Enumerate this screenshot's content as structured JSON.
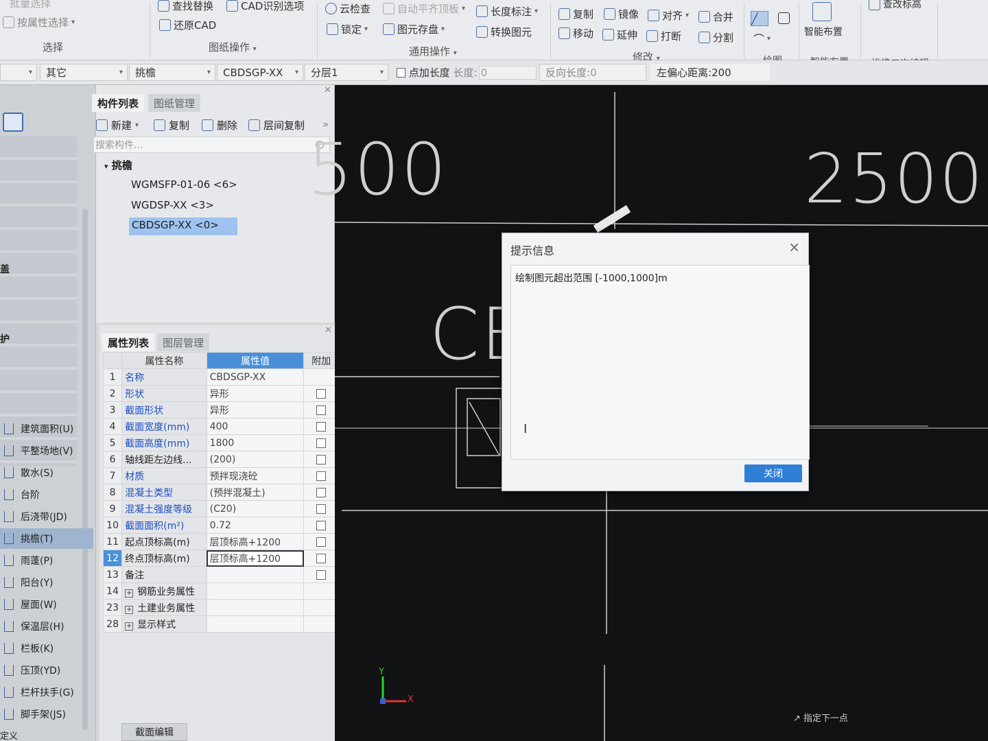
{
  "ribbon": {
    "select_group": {
      "top_label": "批量选择",
      "attr_select": "按属性选择",
      "group_label": "选择"
    },
    "drawing_ops": {
      "find_replace": "查找替换",
      "cad_options": "CAD识别选项",
      "restore_cad": "还原CAD",
      "group_label": "图纸操作"
    },
    "general_ops": {
      "cloud_check": "云检查",
      "auto_flush": "自动平齐顶板",
      "length_mark": "长度标注",
      "lock": "锁定",
      "save_elements": "图元存盘",
      "convert": "转换图元",
      "group_label": "通用操作"
    },
    "modify": {
      "copy": "复制",
      "mirror": "镜像",
      "align": "对齐",
      "merge": "合并",
      "move": "移动",
      "extend": "延伸",
      "break": "打断",
      "split": "分割",
      "group_label": "修改"
    },
    "draw": {
      "group_label": "绘图"
    },
    "smart": {
      "button": "智能布置",
      "group_label": "智能布置"
    },
    "edit2": {
      "view_elev": "查改标高",
      "group_label": "挑檐二次编辑"
    }
  },
  "propbar": {
    "dd1": "",
    "dd2": "其它",
    "dd3": "挑檐",
    "dd4": "CBDSGP-XX",
    "dd5": "分层1",
    "add_length": "点加长度",
    "length_label": "长度:",
    "length_value": "0",
    "reverse_label": "反向长度:",
    "reverse_value": "0",
    "offset_label": "左偏心距离:",
    "offset_value": "200"
  },
  "leftnav": {
    "items": [
      {
        "label": "建筑面积(U)",
        "icon": "building-area-icon"
      },
      {
        "label": "平整场地(V)",
        "icon": "site-leveling-icon"
      },
      {
        "label": "散水(S)",
        "icon": "apron-icon"
      },
      {
        "label": "台阶",
        "icon": "steps-icon"
      },
      {
        "label": "后浇带(JD)",
        "icon": "post-cast-strip-icon"
      },
      {
        "label": "挑檐(T)",
        "icon": "eave-icon",
        "active": true
      },
      {
        "label": "雨蓬(P)",
        "icon": "canopy-icon"
      },
      {
        "label": "阳台(Y)",
        "icon": "balcony-icon"
      },
      {
        "label": "屋面(W)",
        "icon": "roof-icon"
      },
      {
        "label": "保温层(H)",
        "icon": "insulation-icon"
      },
      {
        "label": "栏板(K)",
        "icon": "parapet-icon"
      },
      {
        "label": "压顶(YD)",
        "icon": "coping-icon"
      },
      {
        "label": "栏杆扶手(G)",
        "icon": "railing-icon"
      },
      {
        "label": "脚手架(JS)",
        "icon": "scaffold-icon"
      }
    ],
    "side_labels": [
      "盖",
      "护"
    ],
    "footer": "定义"
  },
  "component_panel": {
    "tabs": [
      "构件列表",
      "图纸管理"
    ],
    "toolbar": {
      "new": "新建",
      "copy": "复制",
      "delete": "删除",
      "floor_copy": "层间复制"
    },
    "search_placeholder": "搜索构件...",
    "tree_root": "挑檐",
    "tree_items": [
      "WGMSFP-01-06 <6>",
      "WGDSP-XX <3>",
      "CBDSGP-XX <0>"
    ]
  },
  "property_panel": {
    "tabs": [
      "属性列表",
      "图层管理"
    ],
    "headers": [
      "属性名称",
      "属性值",
      "附加"
    ],
    "rows": [
      {
        "no": "1",
        "name": "名称",
        "value": "CBDSGP-XX",
        "check": false
      },
      {
        "no": "2",
        "name": "形状",
        "value": "异形",
        "check": true
      },
      {
        "no": "3",
        "name": "截面形状",
        "value": "异形",
        "check": true
      },
      {
        "no": "4",
        "name": "截面宽度(mm)",
        "value": "400",
        "check": true
      },
      {
        "no": "5",
        "name": "截面高度(mm)",
        "value": "1800",
        "check": true
      },
      {
        "no": "6",
        "name": "轴线距左边线...",
        "value": "(200)",
        "check": true,
        "black": true
      },
      {
        "no": "7",
        "name": "材质",
        "value": "预拌现浇砼",
        "check": true
      },
      {
        "no": "8",
        "name": "混凝土类型",
        "value": "(预拌混凝土)",
        "check": true
      },
      {
        "no": "9",
        "name": "混凝土强度等级",
        "value": "(C20)",
        "check": true
      },
      {
        "no": "10",
        "name": "截面面积(m²)",
        "value": "0.72",
        "check": true
      },
      {
        "no": "11",
        "name": "起点顶标高(m)",
        "value": "层顶标高+1200",
        "check": true,
        "black": true
      },
      {
        "no": "12",
        "name": "终点顶标高(m)",
        "value": "层顶标高+1200",
        "check": true,
        "black": true,
        "selected": true
      },
      {
        "no": "13",
        "name": "备注",
        "value": "",
        "check": true,
        "black": true
      },
      {
        "no": "14",
        "name": "钢筋业务属性",
        "value": "",
        "check": false,
        "black": true,
        "group": true
      },
      {
        "no": "23",
        "name": "土建业务属性",
        "value": "",
        "check": false,
        "black": true,
        "group": true
      },
      {
        "no": "28",
        "name": "显示样式",
        "value": "",
        "check": false,
        "black": true,
        "group": true
      }
    ],
    "bottom_button": "截面编辑"
  },
  "canvas": {
    "dim_left": "500",
    "dim_right": "2500",
    "label_cb": "CB",
    "axis_x": "X",
    "axis_y": "Y",
    "status_hint": "指定下一点"
  },
  "dialog": {
    "title": "提示信息",
    "message": "绘制图元超出范围 [-1000,1000]m",
    "close_button": "关闭"
  },
  "colors": {
    "accent": "#4a90d9",
    "canvas_bg": "#111214",
    "dialog_button": "#2f7fd6"
  }
}
